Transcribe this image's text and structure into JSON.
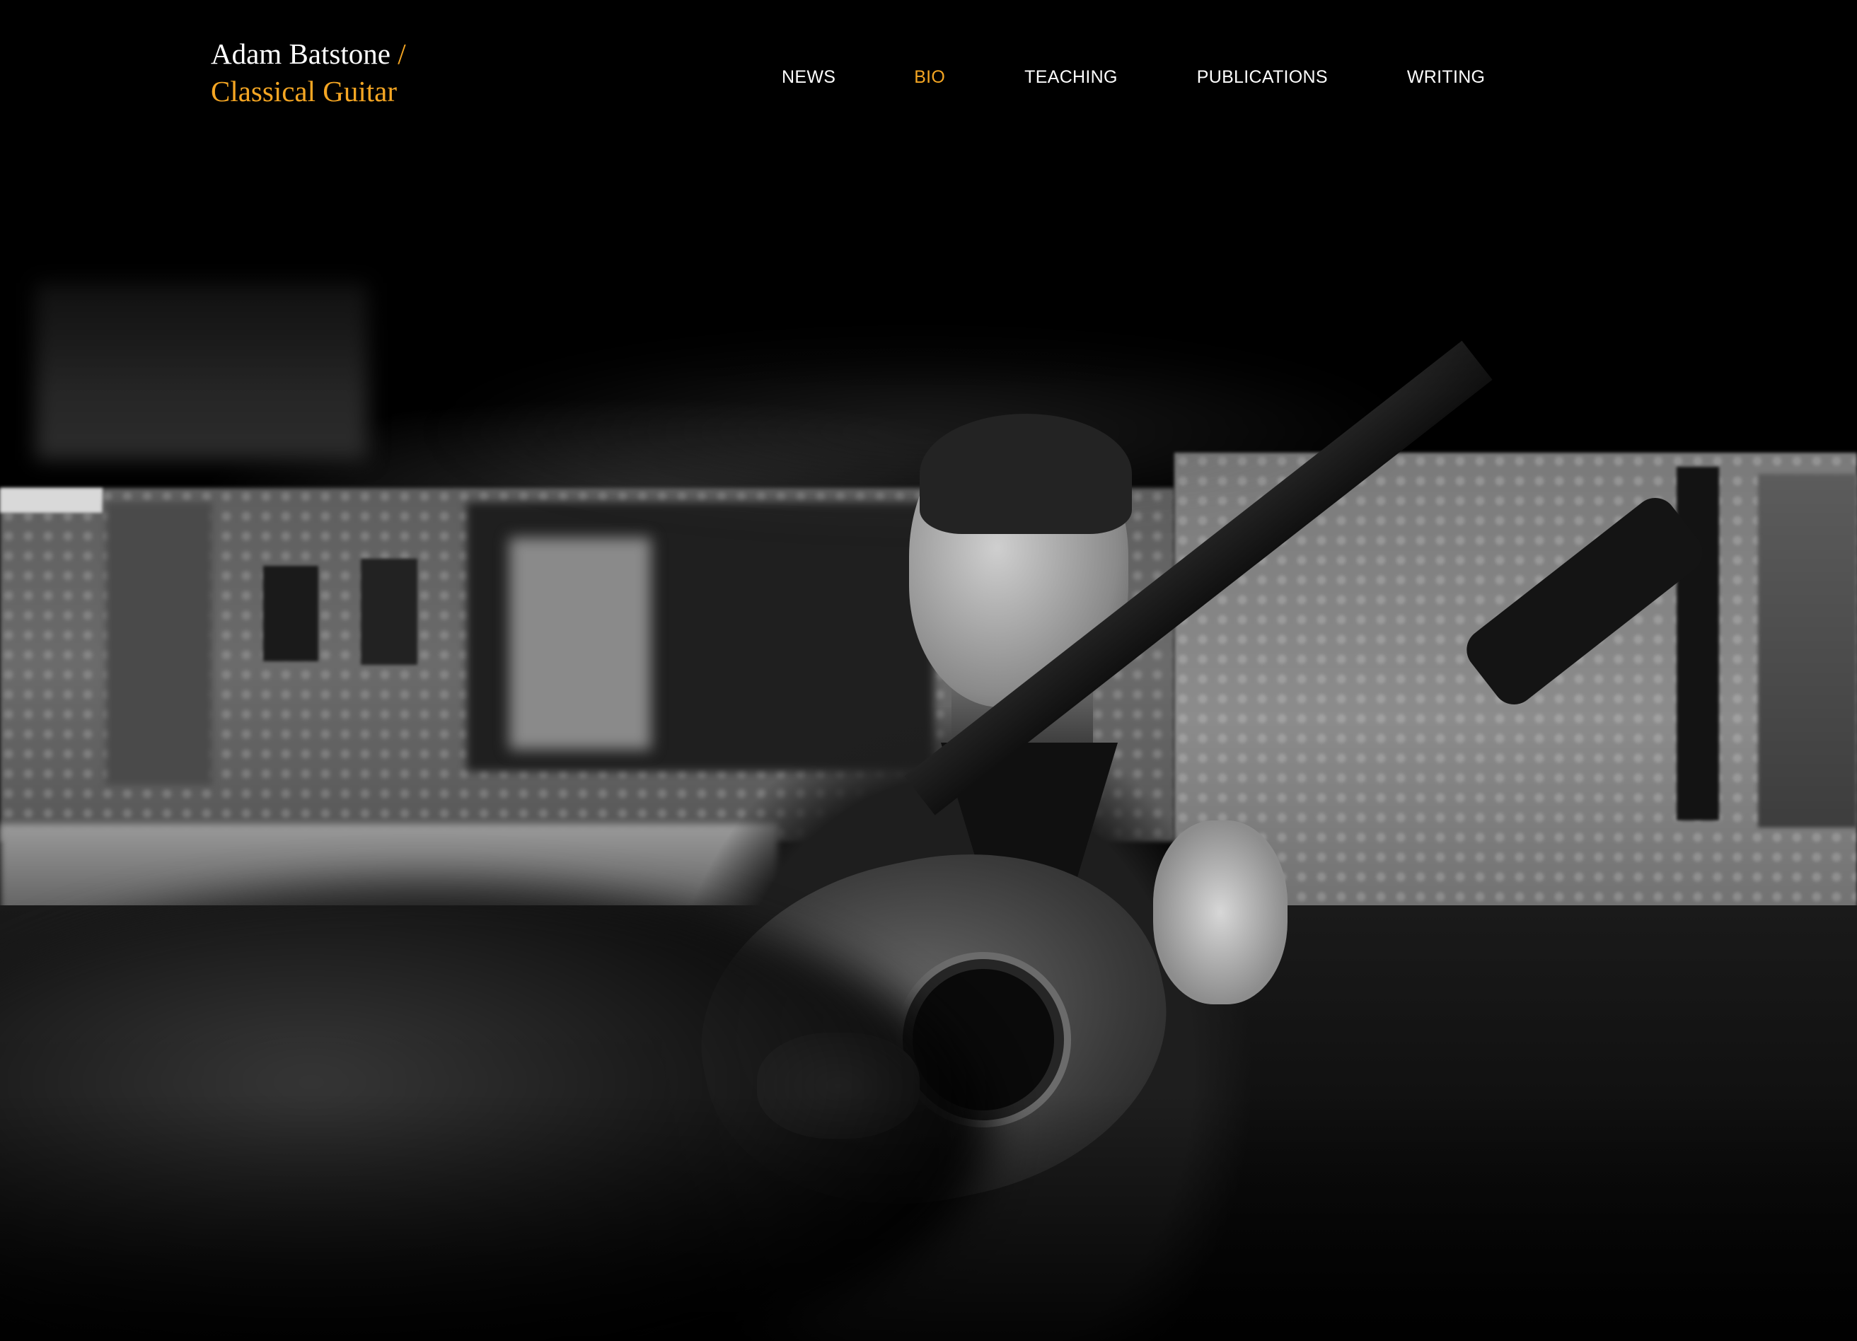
{
  "site": {
    "name": "Adam Batstone",
    "separator": "/",
    "subtitle": "Classical Guitar"
  },
  "nav": {
    "items": [
      {
        "label": "NEWS",
        "active": false
      },
      {
        "label": "BIO",
        "active": true
      },
      {
        "label": "TEACHING",
        "active": false
      },
      {
        "label": "PUBLICATIONS",
        "active": false
      },
      {
        "label": "WRITING",
        "active": false
      }
    ]
  },
  "colors": {
    "accent": "#f5a623",
    "background": "#000000",
    "text": "#ffffff"
  },
  "hero": {
    "image": "hero-photo"
  }
}
